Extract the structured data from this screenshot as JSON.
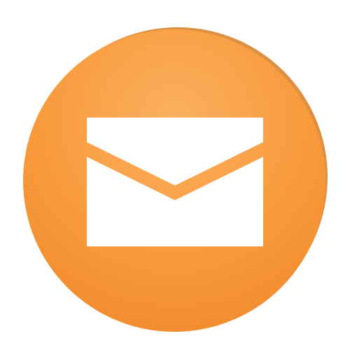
{
  "app_icon": {
    "icon": "mail-envelope-icon",
    "colors": {
      "background": "#ffffff",
      "circle_light": "#fbb05f",
      "circle_mid": "#f89a3c",
      "circle_dark": "#f08b2c",
      "rim_shadow": "#d9832e",
      "envelope": "#ffffff"
    }
  }
}
